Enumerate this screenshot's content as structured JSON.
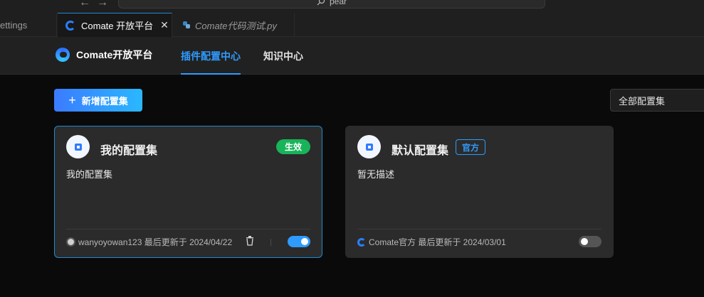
{
  "titlebar": {
    "search_text": "pear"
  },
  "tabs": [
    {
      "label": "ettings"
    },
    {
      "label": "Comate 开放平台",
      "close": "✕"
    },
    {
      "label": "Comate代码测试.py"
    }
  ],
  "header": {
    "brand": "Comate开放平台",
    "nav": [
      "插件配置中心",
      "知识中心"
    ]
  },
  "toolbar": {
    "add_label": "新增配置集",
    "filter_value": "全部配置集"
  },
  "cards": [
    {
      "title": "我的配置集",
      "badge": "生效",
      "description": "我的配置集",
      "meta": "wanyoyowan123 最后更新于 2024/04/22",
      "enabled": true
    },
    {
      "title": "默认配置集",
      "badge": "官方",
      "description": "暂无描述",
      "meta": "Comate官方 最后更新于 2024/03/01",
      "enabled": false
    }
  ],
  "colors": {
    "accent": "#2f9bff",
    "success": "#19b35a",
    "card_bg": "#2b2b2b"
  }
}
